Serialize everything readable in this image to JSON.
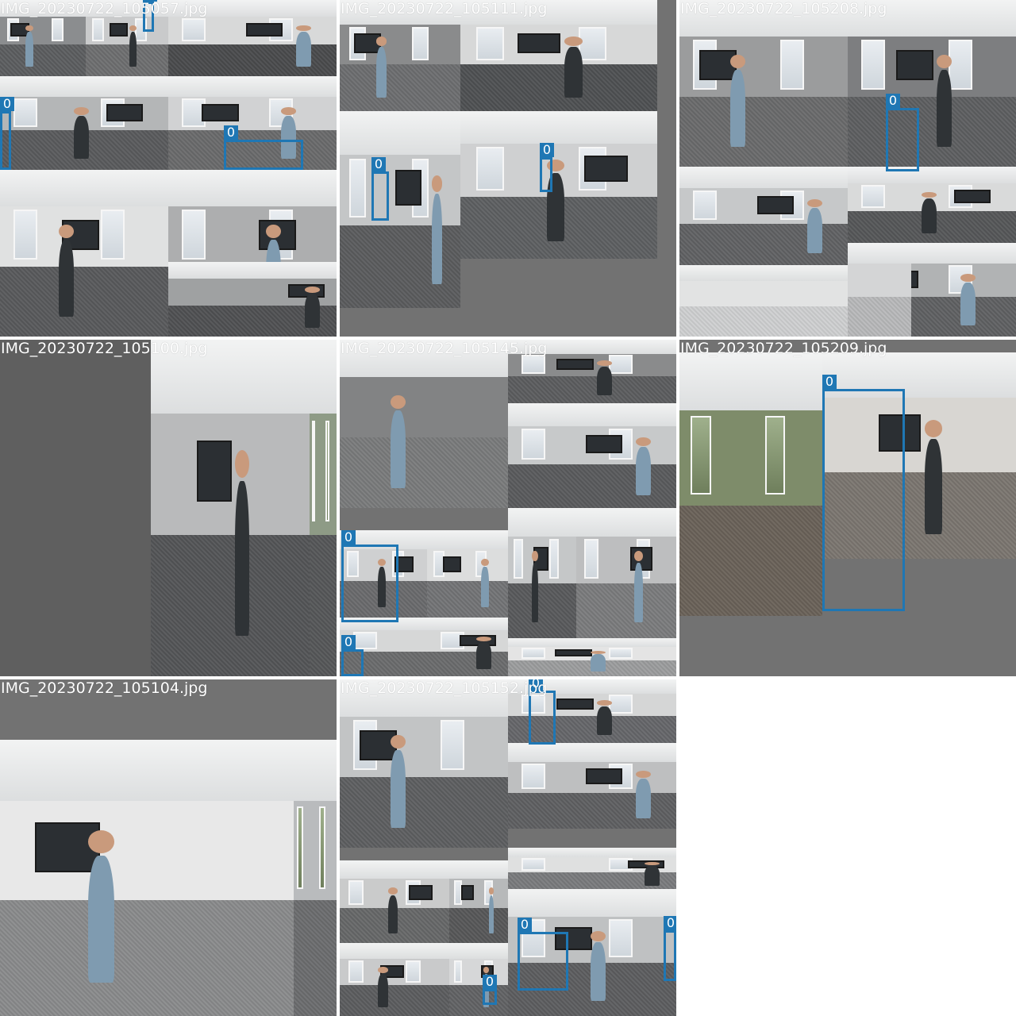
{
  "mosaic": {
    "cells": [
      {
        "caption": "IMG_20230722_105057.jpg",
        "tiles": [
          {
            "color": "#8b8d8f",
            "floor": "#5c5e60",
            "scene": "office"
          },
          {
            "color": "#c9cacb",
            "floor": "#6e6f70",
            "scene": "office"
          },
          {
            "color": "#d8d9d9",
            "floor": "#4a4b4d",
            "scene": "office"
          },
          {
            "color": "#b4b6b7",
            "floor": "#5a5b5d",
            "scene": "office"
          },
          {
            "color": "#d1d2d3",
            "floor": "#6a6b6c",
            "scene": "office"
          },
          {
            "color": "#e0e1e1",
            "floor": "#595a5c",
            "scene": "office"
          },
          {
            "color": "#adaeaf",
            "floor": "#59595b",
            "scene": "office"
          },
          {
            "color": "#9fa1a2",
            "floor": "#505153",
            "scene": "room"
          }
        ],
        "boxes": [
          {
            "label": "0"
          },
          {
            "label": "0"
          },
          {
            "label": "0"
          }
        ]
      },
      {
        "caption": "IMG_20230722_105111.jpg",
        "tiles": [
          {
            "color": "#8a8b8c",
            "floor": "#6d6e70",
            "scene": "office"
          },
          {
            "color": "#d7d8d8",
            "floor": "#4f5153",
            "scene": "office"
          },
          {
            "color": "#c4c6c7",
            "floor": "#5b5c5e",
            "scene": "office"
          },
          {
            "color": "#cfd0d1",
            "floor": "#5e6062",
            "scene": "office"
          }
        ],
        "boxes": [
          {
            "label": "0"
          },
          {
            "label": "0"
          }
        ]
      },
      {
        "caption": "IMG_20230722_105208.jpg",
        "tiles": [
          {
            "color": "#9b9c9d",
            "floor": "#6a6b6c",
            "scene": "office"
          },
          {
            "color": "#7d7e80",
            "floor": "#5e5f61",
            "scene": "office"
          },
          {
            "color": "#c6c8c9",
            "floor": "#616264",
            "scene": "office"
          },
          {
            "color": "#d9dada",
            "floor": "#565759",
            "scene": "office"
          },
          {
            "color": "#b1b3b4",
            "floor": "#606163",
            "scene": "office"
          },
          {
            "color": "#e2e3e3",
            "floor": "#cfd0d1",
            "scene": "ceiling"
          },
          {
            "color": "#d4d5d6",
            "floor": "#b8b9ba",
            "scene": "ceiling"
          }
        ],
        "boxes": [
          {
            "label": "0"
          }
        ]
      },
      {
        "caption": "IMG_20230722_105100.jpg",
        "tiles": [
          {
            "color": "#5f5f5f",
            "floor": "#5f5f5f",
            "scene": "blank"
          },
          {
            "color": "#b9babb",
            "floor": "#545557",
            "scene": "room"
          },
          {
            "color": "#8e9b86",
            "floor": "#565759",
            "scene": "window"
          }
        ],
        "boxes": []
      },
      {
        "caption": "IMG_20230722_105145.jpg",
        "tiles": [
          {
            "color": "#828384",
            "floor": "#7a7b7c",
            "scene": "portrait"
          },
          {
            "color": "#8a8b8c",
            "floor": "#5c5d5f",
            "scene": "office"
          },
          {
            "color": "#c7c9ca",
            "floor": "#5a5b5d",
            "scene": "office"
          },
          {
            "color": "#cfd0d1",
            "floor": "#6a6b6d",
            "scene": "office"
          },
          {
            "color": "#dcdddd",
            "floor": "#737476",
            "scene": "office"
          },
          {
            "color": "#c5c7c8",
            "floor": "#595a5c",
            "scene": "office"
          },
          {
            "color": "#bdbebf",
            "floor": "#7b7c7d",
            "scene": "office"
          },
          {
            "color": "#d6d7d7",
            "floor": "#6b6c6d",
            "scene": "office"
          },
          {
            "color": "#e4e4e4",
            "floor": "#9c9d9e",
            "scene": "office"
          },
          {
            "color": "#e9eaea",
            "floor": "#d1d2d2",
            "scene": "ceiling"
          }
        ],
        "boxes": [
          {
            "label": "0"
          },
          {
            "label": "0"
          }
        ]
      },
      {
        "caption": "IMG_20230722_105209.jpg",
        "tiles": [
          {
            "color": "#7e8c6a",
            "floor": "#6a6259",
            "scene": "window"
          },
          {
            "color": "#d8d6d2",
            "floor": "#7b7670",
            "scene": "room"
          }
        ],
        "boxes": [
          {
            "label": "0"
          }
        ]
      },
      {
        "caption": "IMG_20230722_105104.jpg",
        "tiles": [
          {
            "color": "#e8e8e8",
            "floor": "#8a8b8c",
            "scene": "room"
          },
          {
            "color": "#b9bbbd",
            "floor": "#6c6d6f",
            "scene": "window"
          }
        ],
        "boxes": []
      },
      {
        "caption": "IMG_20230722_105152.jpg",
        "tiles": [
          {
            "color": "#c2c4c5",
            "floor": "#5e5f61",
            "scene": "office"
          },
          {
            "color": "#d5d6d6",
            "floor": "#66676a",
            "scene": "office"
          },
          {
            "color": "#bebfc0",
            "floor": "#5f6062",
            "scene": "office"
          },
          {
            "color": "#cacbcb",
            "floor": "#676869",
            "scene": "office"
          },
          {
            "color": "#b7b9ba",
            "floor": "#575859",
            "scene": "office"
          },
          {
            "color": "#c9cacb",
            "floor": "#5c5d5f",
            "scene": "office"
          },
          {
            "color": "#d6d7d8",
            "floor": "#626365",
            "scene": "office"
          },
          {
            "color": "#dfe0e0",
            "floor": "#7a7b7d",
            "scene": "office"
          },
          {
            "color": "#bfc1c2",
            "floor": "#5d5e60",
            "scene": "office"
          }
        ],
        "boxes": [
          {
            "label": "0"
          },
          {
            "label": "0"
          },
          {
            "label": "0"
          },
          {
            "label": "0"
          }
        ]
      }
    ],
    "colors": {
      "box": "#1f77b4",
      "caption": "#ffffff",
      "letterbox": "#727272",
      "background": "#ffffff"
    }
  }
}
